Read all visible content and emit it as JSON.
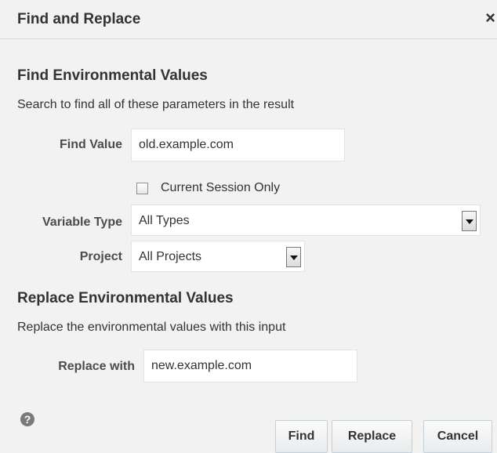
{
  "dialog": {
    "title": "Find and Replace",
    "close_glyph": "×"
  },
  "find_section": {
    "title": "Find Environmental Values",
    "description": "Search to find all of these parameters in the result",
    "find_value_label": "Find Value",
    "find_value": "old.example.com",
    "current_session_label": "Current Session Only",
    "current_session_checked": false,
    "variable_type_label": "Variable Type",
    "variable_type_value": "All Types",
    "project_label": "Project",
    "project_value": "All Projects"
  },
  "replace_section": {
    "title": "Replace Environmental Values",
    "description": "Replace the environmental values with this input",
    "replace_with_label": "Replace with",
    "replace_value": "new.example.com"
  },
  "footer": {
    "help_glyph": "?",
    "find_label": "Find",
    "replace_label": "Replace",
    "cancel_label": "Cancel"
  }
}
